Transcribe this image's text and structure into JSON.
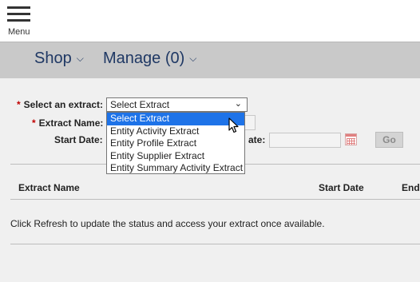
{
  "header": {
    "menu_label": "Menu"
  },
  "nav": {
    "items": [
      {
        "label": "Shop"
      },
      {
        "label": "Manage (0)"
      }
    ]
  },
  "form": {
    "required_marker": "*",
    "extract_label": "Select an extract:",
    "extract_selected": "Select Extract",
    "name_label": "Extract Name:",
    "start_date_label": "Start Date:",
    "end_date_label_partial": "ate:",
    "go_label": "Go"
  },
  "dropdown": {
    "options": [
      "Select Extract",
      "Entity Activity Extract",
      "Entity Profile Extract",
      "Entity Supplier Extract",
      "Entity Summary Activity Extract"
    ],
    "highlighted_index": 0
  },
  "table": {
    "columns": [
      "Extract Name",
      "Start Date",
      "End"
    ]
  },
  "info": {
    "text": "Click Refresh to update the status and access your extract once available."
  },
  "colors": {
    "nav_text": "#1f3864",
    "required": "#c00000",
    "highlight": "#1e73e8",
    "navbar_bg": "#c9c9c9"
  }
}
